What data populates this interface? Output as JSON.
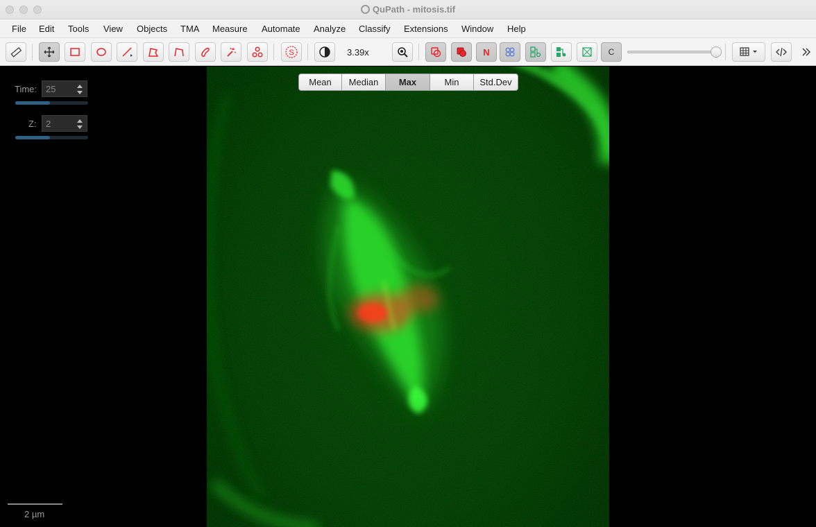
{
  "window": {
    "title": "QuPath - mitosis.tif"
  },
  "menu": [
    "File",
    "Edit",
    "Tools",
    "View",
    "Objects",
    "TMA",
    "Measure",
    "Automate",
    "Analyze",
    "Classify",
    "Extensions",
    "Window",
    "Help"
  ],
  "toolbar": {
    "zoom": "3.39x",
    "channels_label": "C",
    "points_label": "N",
    "selection_mode_label": "S"
  },
  "projection": {
    "options": [
      "Mean",
      "Median",
      "Max",
      "Min",
      "Std.Dev"
    ],
    "selected": "Max"
  },
  "controls": {
    "time_label": "Time:",
    "time_value": "25",
    "time_progress": 0.48,
    "z_label": "Z:",
    "z_value": "2",
    "z_progress": 0.48
  },
  "scalebar": {
    "label": "2 µm"
  },
  "colors": {
    "accent_red": "#e8252b",
    "accent_green": "#2aa66a",
    "accent_blue": "#5b7ed6",
    "spindle_green": "#2fe02f",
    "chromosome_red": "#ff2a1a"
  }
}
